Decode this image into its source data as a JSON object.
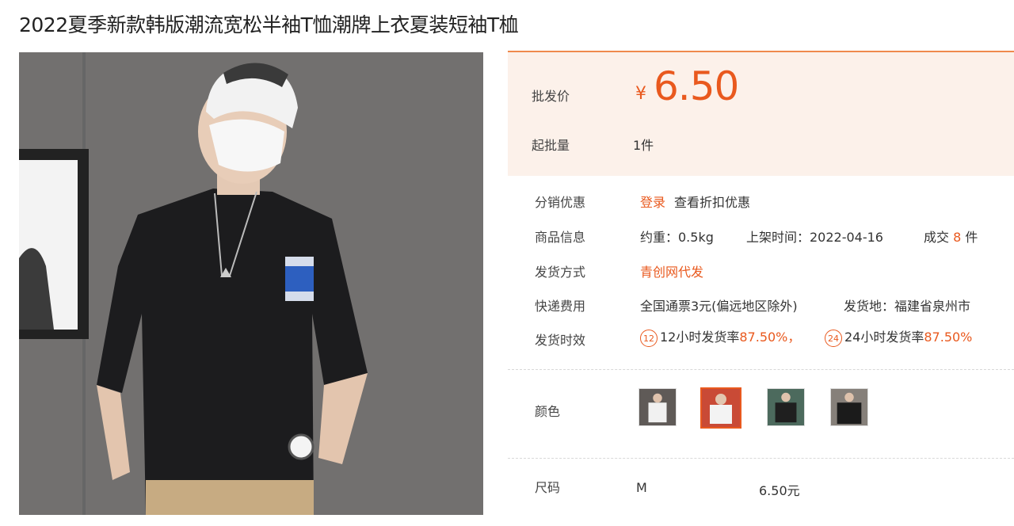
{
  "product": {
    "title": "2022夏季新款韩版潮流宽松半袖T恤潮牌上衣夏装短袖T桖"
  },
  "price_box": {
    "price_label": "批发价",
    "currency": "¥",
    "price": "6.50",
    "moq_label": "起批量",
    "moq_value": "1件"
  },
  "details": {
    "discount_label": "分销优惠",
    "discount_login": "登录",
    "discount_text": "查看折扣优惠",
    "info_label": "商品信息",
    "weight": "约重：0.5kg",
    "listed": "上架时间：2022-04-16",
    "deals_prefix": "成交",
    "deals_count": "8",
    "deals_suffix": "件",
    "shipping_label": "发货方式",
    "shipping_value": "青创网代发",
    "fee_label": "快递费用",
    "fee_value": "全国通票3元(偏远地区除外)",
    "origin": "发货地：福建省泉州市",
    "timing_label": "发货时效",
    "badge_12": "12",
    "rate_12_text": "12小时发货率",
    "rate_12_value": "87.50%，",
    "badge_24": "24",
    "rate_24_text": "24小时发货率",
    "rate_24_value": "87.50%"
  },
  "color": {
    "label": "颜色",
    "swatches": [
      "white-tee-photo",
      "red-tee-photo",
      "black-tee-photo",
      "black-oversized-tee-photo"
    ],
    "selected_index": 1
  },
  "size": {
    "label": "尺码",
    "option": "M",
    "price": "6.50元"
  },
  "colors": {
    "accent": "#e9591e",
    "price_bg": "#fcf1ea",
    "border_top": "#ef8a4d"
  }
}
